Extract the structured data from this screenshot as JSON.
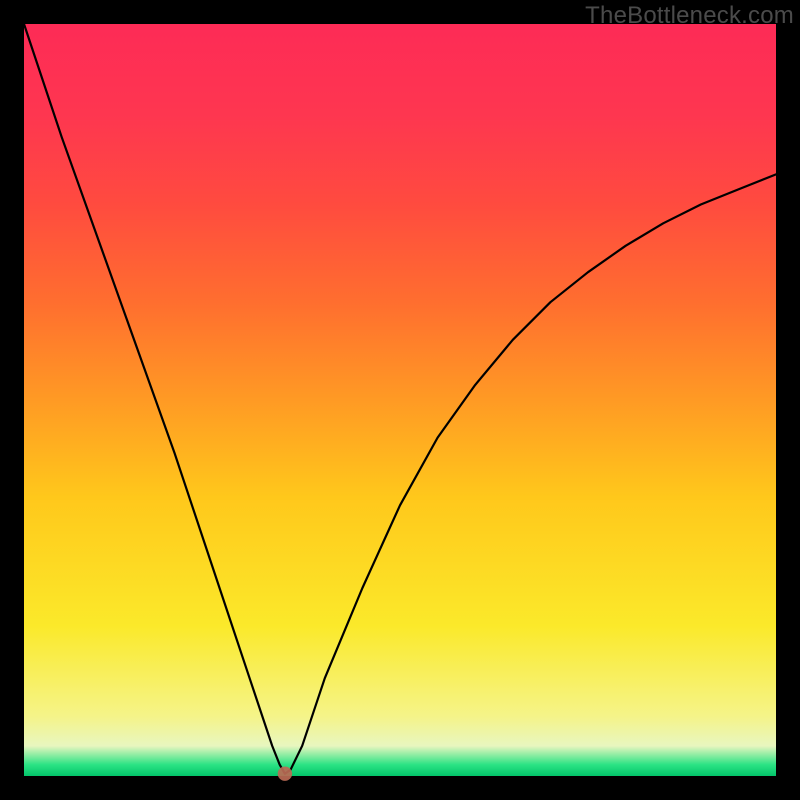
{
  "watermark": "TheBottleneck.com",
  "colors": {
    "top": "#fd2b56",
    "mag": "#fe3650",
    "red": "#ff4b3f",
    "ored": "#ff6e2f",
    "orange": "#ff9a24",
    "yel1": "#ffc81b",
    "yel2": "#fbe92a",
    "pale": "#f5f488",
    "cream": "#e8f6bf",
    "green": "#2be384",
    "dgreen": "#03c46a"
  },
  "chart_data": {
    "type": "line",
    "title": "",
    "xlabel": "",
    "ylabel": "",
    "xlim": [
      0,
      100
    ],
    "ylim": [
      0,
      100
    ],
    "legend": false,
    "grid": false,
    "axes_visible": false,
    "background": "rainbow-vertical-gradient",
    "series": [
      {
        "name": "curve",
        "x": [
          0,
          5,
          10,
          15,
          20,
          25,
          30,
          33,
          34,
          34.7,
          35.5,
          37,
          40,
          45,
          50,
          55,
          60,
          65,
          70,
          75,
          80,
          85,
          90,
          95,
          100
        ],
        "values": [
          100,
          85,
          71,
          57,
          43,
          28,
          13,
          4,
          1.5,
          0.3,
          0.8,
          4,
          13,
          25,
          36,
          45,
          52,
          58,
          63,
          67,
          70.5,
          73.5,
          76,
          78,
          80
        ]
      }
    ],
    "annotations": [
      {
        "name": "min-marker",
        "x": 34.7,
        "y": 0.3,
        "shape": "dot",
        "color": "#bb6a55"
      }
    ],
    "notes": "V-shaped curve; y represents bottleneck percentage (0 at bottom/green, 100 at top/red). Minimum near x≈35."
  }
}
